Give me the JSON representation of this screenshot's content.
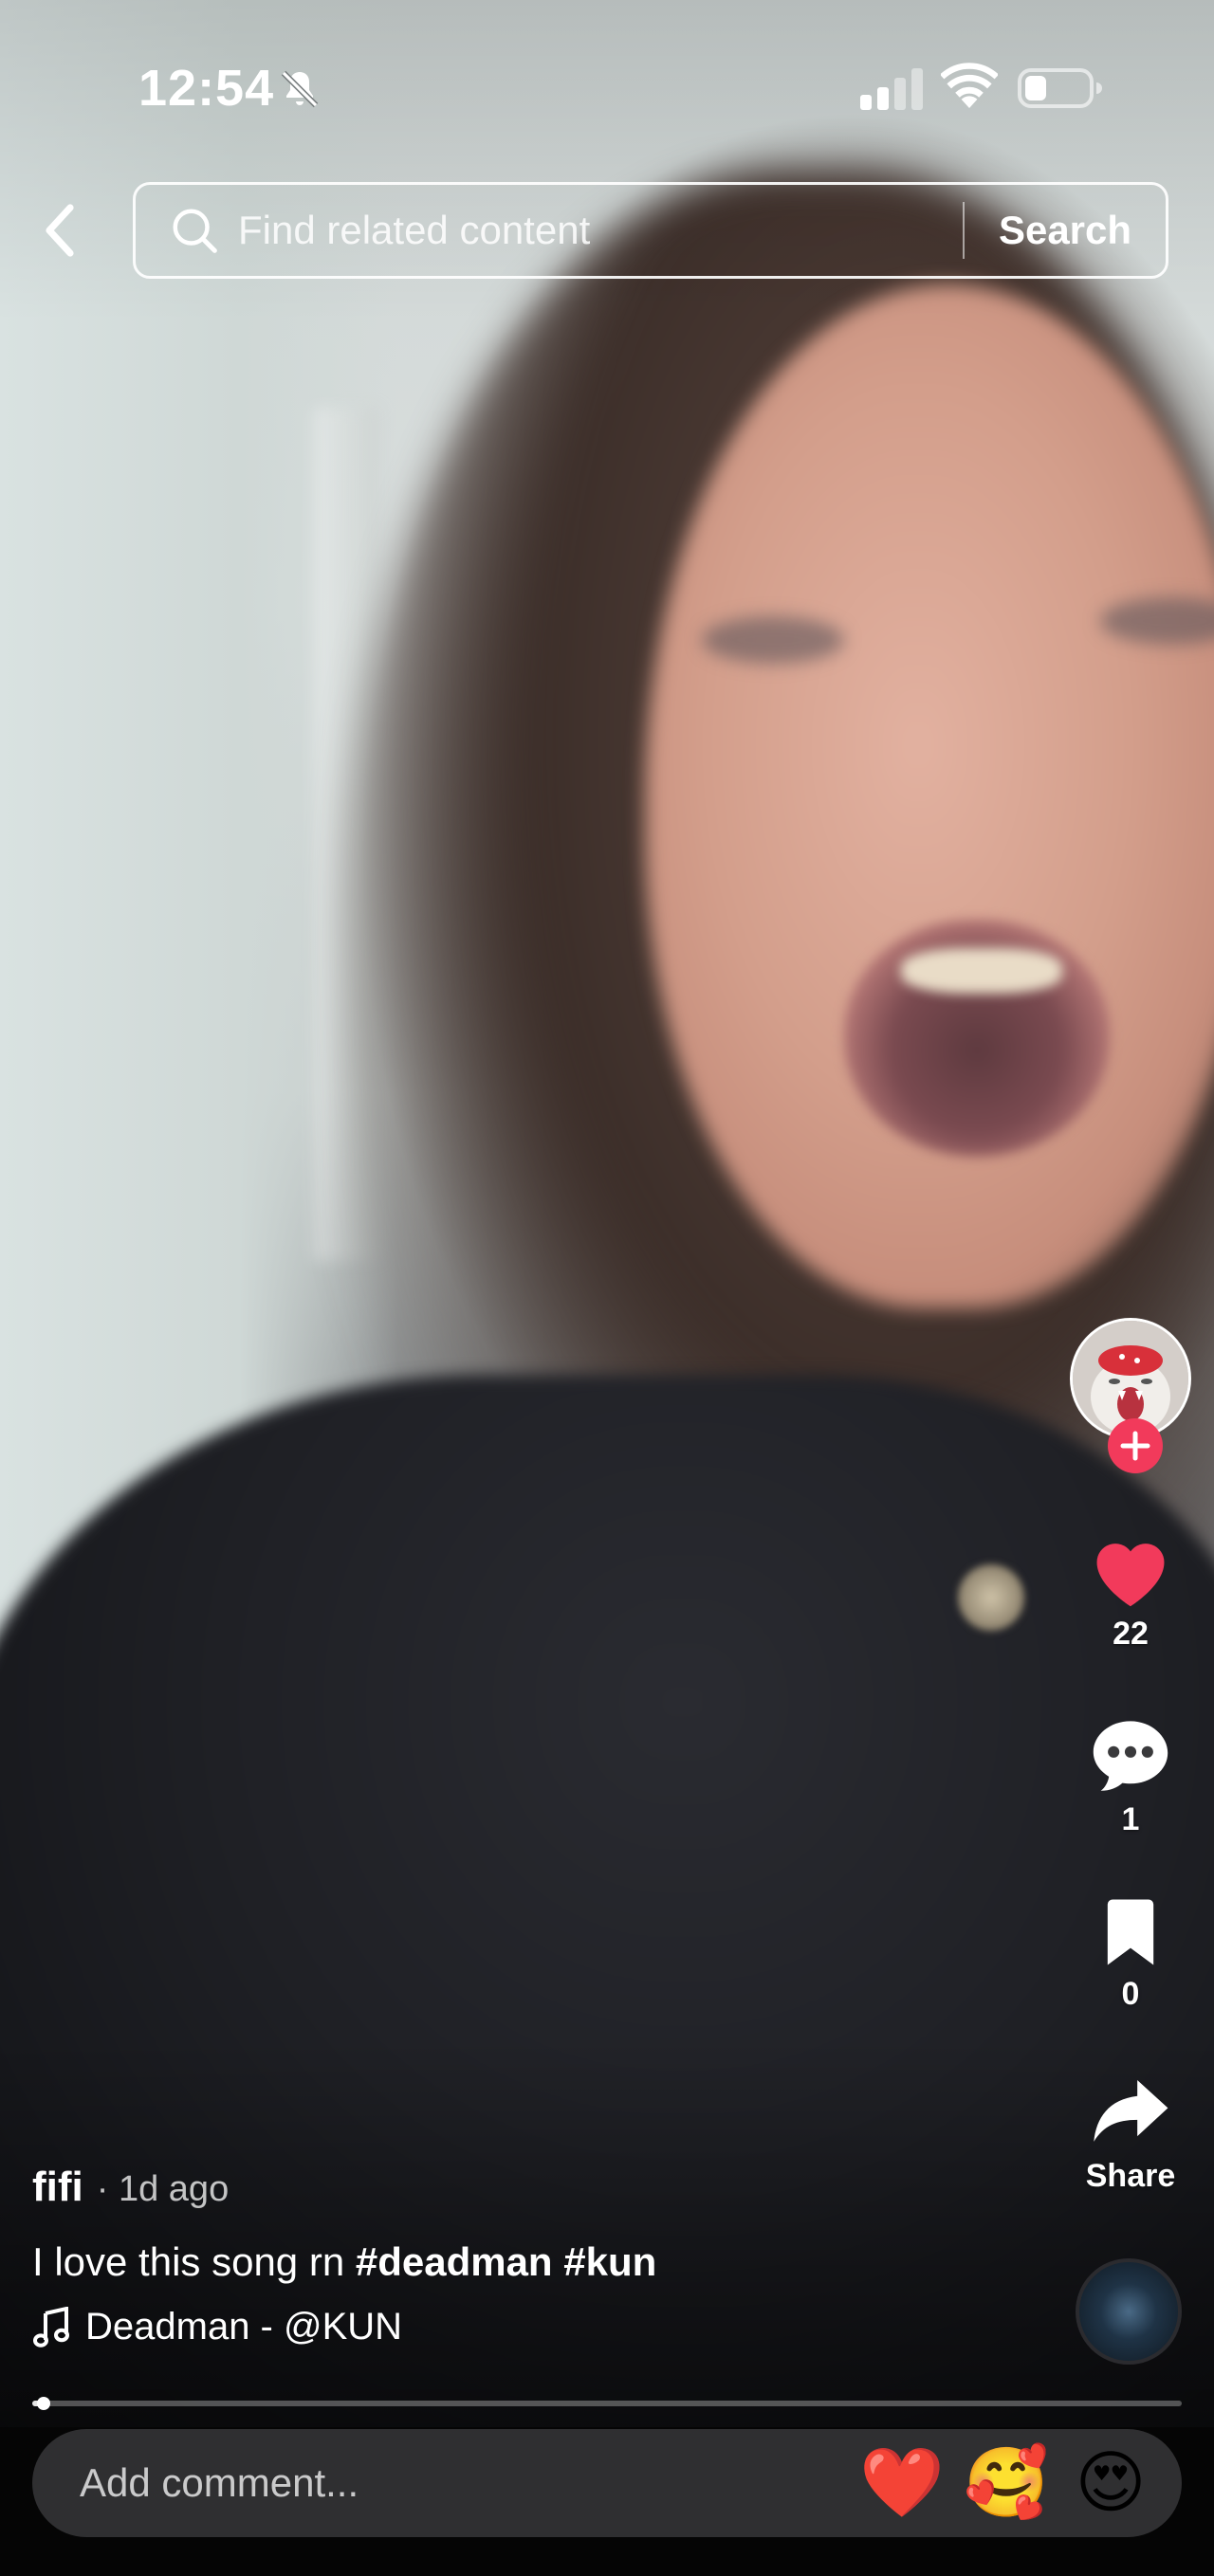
{
  "status_bar": {
    "time": "12:54",
    "icons": [
      "bell-slash-icon",
      "cellular-signal-icon",
      "wifi-icon",
      "battery-icon"
    ]
  },
  "header": {
    "back_icon": "chevron-left-icon",
    "search": {
      "placeholder": "Find related content",
      "value": "",
      "icon": "search-icon",
      "button_label": "Search"
    }
  },
  "rail": {
    "avatar_icon": "creator-avatar",
    "follow_icon": "plus-icon",
    "like": {
      "icon": "heart-icon",
      "count": "22",
      "color": "#f23a5b"
    },
    "comment": {
      "icon": "comment-bubble-icon",
      "count": "1"
    },
    "save": {
      "icon": "bookmark-icon",
      "count": "0"
    },
    "share": {
      "icon": "share-arrow-icon",
      "label": "Share"
    },
    "music_disc_icon": "music-disc"
  },
  "caption": {
    "author": "fifi",
    "meta": "· 1d ago",
    "description_text": "I love this song rn",
    "hashtags": [
      "#deadman",
      "#kun"
    ],
    "sound_icon": "music-note-icon",
    "sound": "Deadman - @KUN"
  },
  "progress": {
    "fraction": 0.01
  },
  "comment_bar": {
    "placeholder": "Add comment...",
    "quick_emojis": [
      "❤️",
      "🥰",
      "😍"
    ]
  },
  "colors": {
    "accent": "#f23a5b",
    "comment_bar_bg": "#2f2f31",
    "bottom_bg": "#050505"
  }
}
